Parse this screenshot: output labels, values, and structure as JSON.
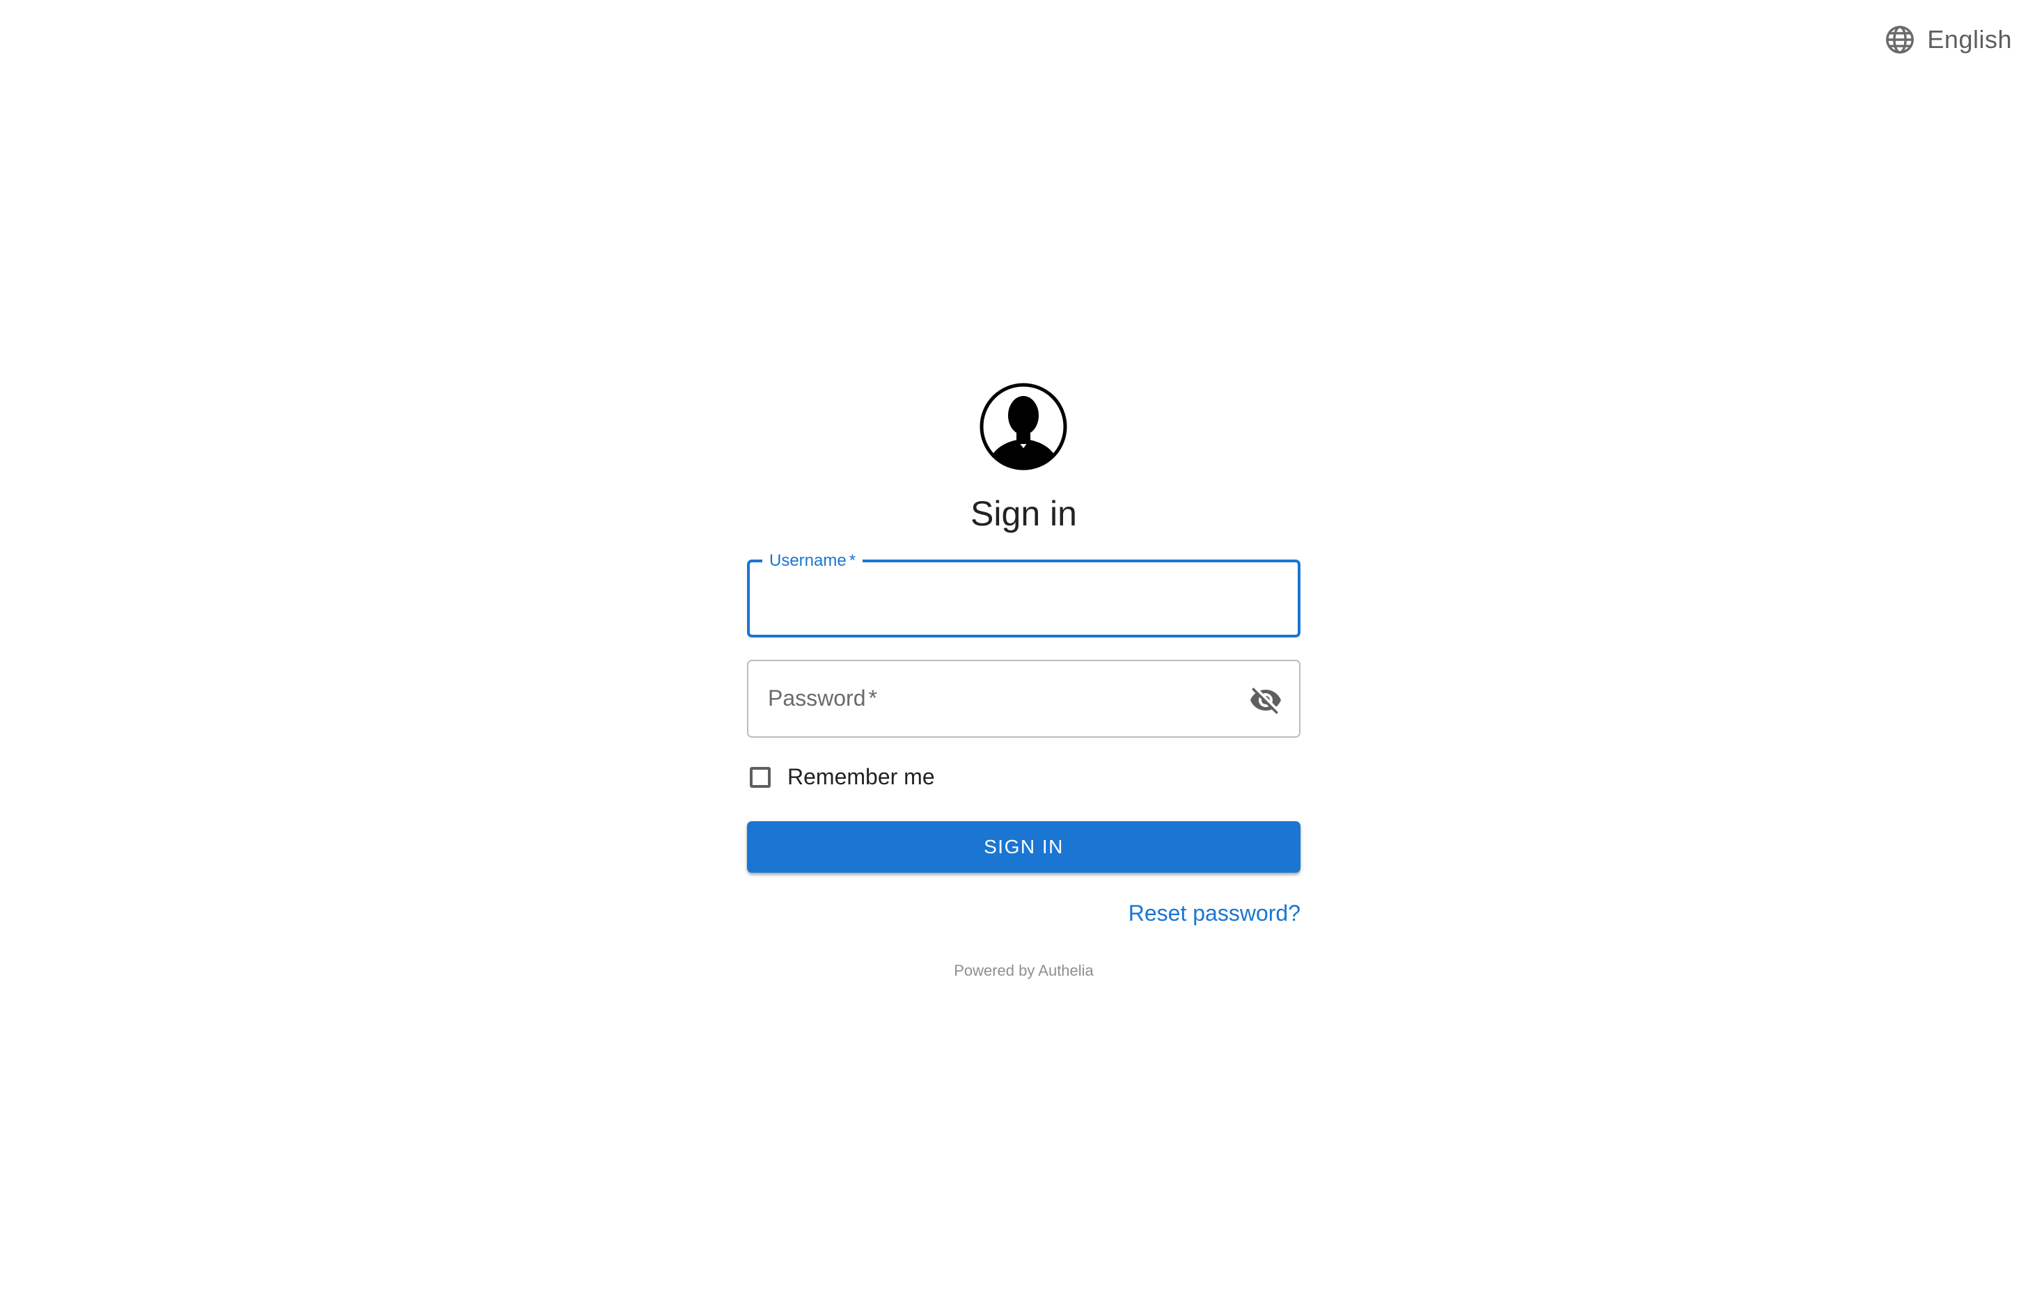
{
  "language_selector": {
    "icon": "globe-icon",
    "label": "English"
  },
  "avatar": {
    "icon": "user-silhouette-icon"
  },
  "page_title": "Sign in",
  "username_field": {
    "label": "Username",
    "required_marker": "*",
    "value": "",
    "state": "focused"
  },
  "password_field": {
    "label": "Password",
    "required_marker": "*",
    "value": "",
    "toggle_icon": "visibility-off-icon"
  },
  "remember_me": {
    "label": "Remember me",
    "checked": false
  },
  "signin_button": {
    "label": "SIGN IN"
  },
  "reset_password": {
    "label": "Reset password?"
  },
  "footer": {
    "powered_by": "Powered by Authelia"
  },
  "colors": {
    "accent": "#1a76d2",
    "border": "#bdbdbd",
    "muted_text": "#8f8f8f",
    "background": "#ffffff"
  }
}
